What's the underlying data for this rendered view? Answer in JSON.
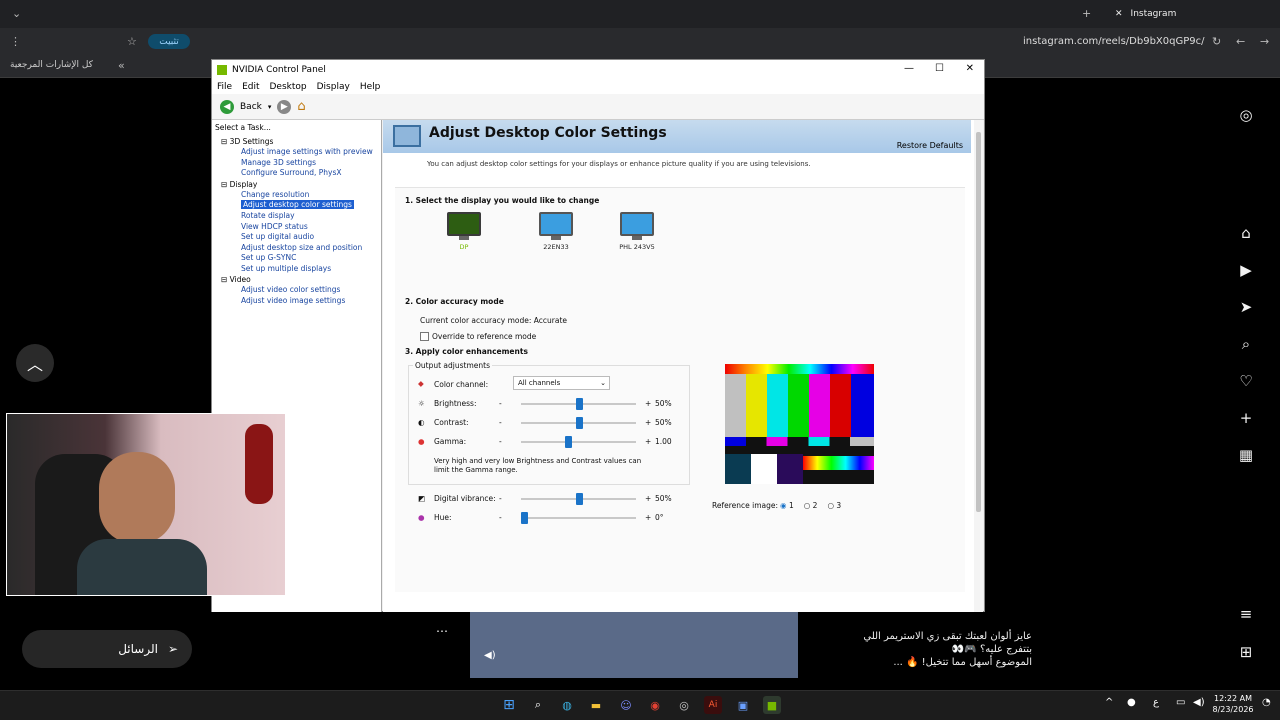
{
  "browser": {
    "tab_title": "Instagram",
    "url": "instagram.com/reels/Db9bX0qGP9c/",
    "install_label": "تثبيت",
    "bookmarks_label": "كل الإشارات المرجعية"
  },
  "instagram": {
    "messages_label": "الرسائل",
    "caption_line1": "عايز ألوان لعبتك تبقى زي الاستريمر اللي",
    "caption_line2": "بتتفرج عليه؟ 🎮👀",
    "caption_line3": "الموضوع أسهل مما تتخيل! 🔥 ..."
  },
  "nvidia": {
    "window_title": "NVIDIA Control Panel",
    "menu": [
      "File",
      "Edit",
      "Desktop",
      "Display",
      "Help"
    ],
    "back_label": "Back",
    "task_header": "Select a Task...",
    "tree": {
      "cat_3d": "3D Settings",
      "items_3d": [
        "Adjust image settings with preview",
        "Manage 3D settings",
        "Configure Surround, PhysX"
      ],
      "cat_display": "Display",
      "items_display": [
        "Change resolution",
        "Adjust desktop color settings",
        "Rotate display",
        "View HDCP status",
        "Set up digital audio",
        "Adjust desktop size and position",
        "Set up G-SYNC",
        "Set up multiple displays"
      ],
      "cat_video": "Video",
      "items_video": [
        "Adjust video color settings",
        "Adjust video image settings"
      ]
    },
    "page_title": "Adjust Desktop Color Settings",
    "restore_defaults": "Restore Defaults",
    "intro": "You can adjust desktop color settings for your displays or enhance picture quality if you are using televisions.",
    "section1": "1. Select the display you would like to change",
    "displays": [
      "DP",
      "22EN33",
      "PHL 243V5"
    ],
    "section2": "2. Color accuracy mode",
    "accuracy_text": "Current color accuracy mode: Accurate",
    "override_label": "Override to reference mode",
    "section3": "3. Apply color enhancements",
    "output_group_label": "Output adjustments",
    "channel_label": "Color channel:",
    "channel_value": "All channels",
    "sliders": [
      {
        "label": "Brightness:",
        "value_text": "50%",
        "fraction": 0.5
      },
      {
        "label": "Contrast:",
        "value_text": "50%",
        "fraction": 0.5
      },
      {
        "label": "Gamma:",
        "value_text": "1.00",
        "fraction": 0.3
      },
      {
        "label": "Digital vibrance:",
        "value_text": "50%",
        "fraction": 0.5
      },
      {
        "label": "Hue:",
        "value_text": "0°",
        "fraction": 0.0
      }
    ],
    "minus": "-",
    "plus": "+",
    "warning": "Very high and very low Brightness and Contrast values can limit the Gamma range.",
    "reference_label": "Reference image:",
    "reference_options": [
      "1",
      "2",
      "3"
    ]
  },
  "taskbar": {
    "time": "12:22 AM",
    "date": "8/23/2026",
    "lang": "ع"
  }
}
